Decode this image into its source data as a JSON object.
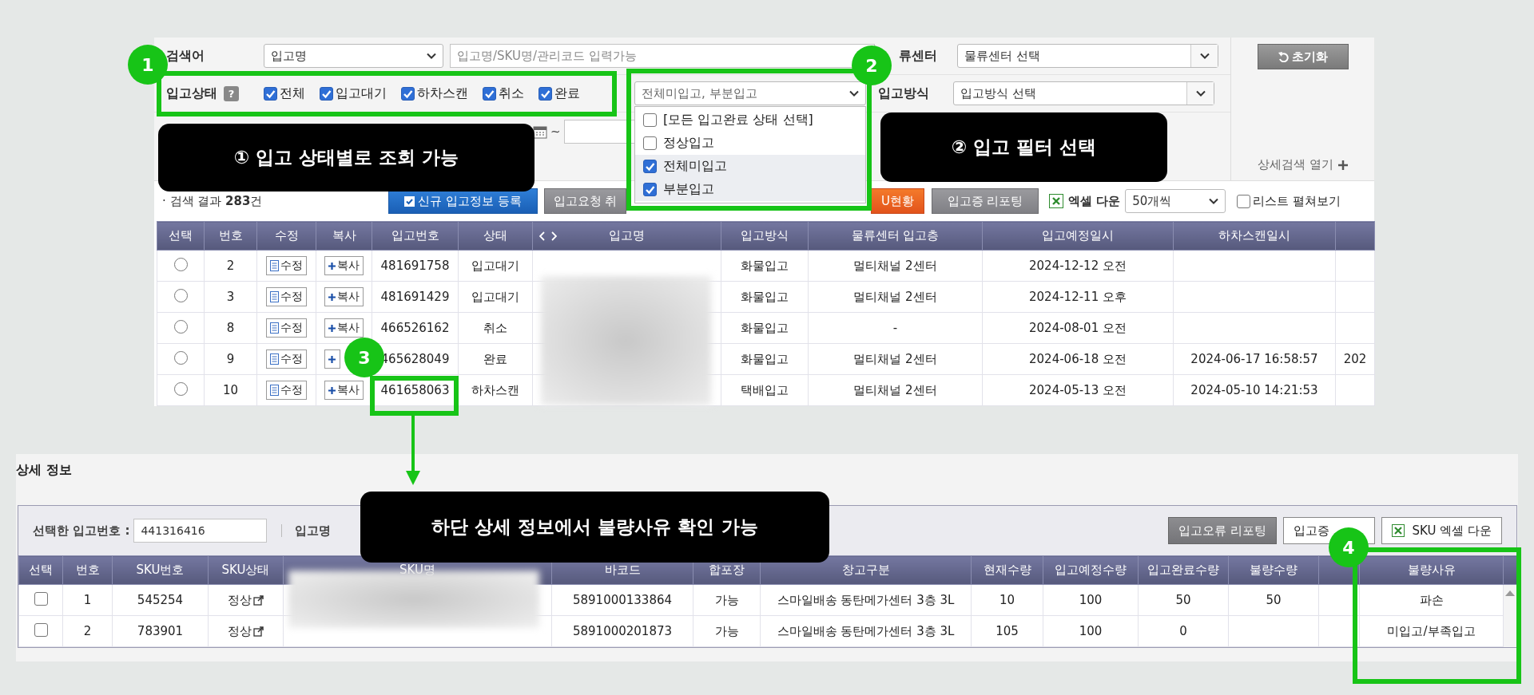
{
  "search": {
    "keyword_label": "검색어",
    "keyword_select": "입고명",
    "keyword_placeholder": "입고명/SKU명/관리코드 입력가능",
    "center_label": "류센터",
    "center_select": "물류센터 선택",
    "reset_button": "초기화",
    "status_label": "입고상태",
    "help_icon": "?",
    "status_checks": [
      {
        "label": "전체",
        "checked": true
      },
      {
        "label": "입고대기",
        "checked": true
      },
      {
        "label": "하차스캔",
        "checked": true
      },
      {
        "label": "취소",
        "checked": true
      },
      {
        "label": "완료",
        "checked": true
      }
    ],
    "filter_select": "전체미입고, 부분입고",
    "filter_options": [
      {
        "label": "[모든 입고완료 상태 선택]",
        "checked": false
      },
      {
        "label": "정상입고",
        "checked": false
      },
      {
        "label": "전체미입고",
        "checked": true
      },
      {
        "label": "부분입고",
        "checked": true
      }
    ],
    "method_label": "입고방식",
    "method_select": "입고방식 선택",
    "date_separator": "~",
    "detail_toggle": "상세검색 열기"
  },
  "results": {
    "summary": "· 검색 결과 **283**건",
    "buttons": [
      {
        "label": "신규 입고정보 등록",
        "kind": "primary"
      },
      {
        "label": "입고요청 취",
        "kind": "secondary"
      },
      {
        "label": "U현황",
        "kind": "warning"
      },
      {
        "label": "입고증 리포팅",
        "kind": "secondary"
      }
    ],
    "excel_label": "엑셀 다운",
    "page_size": "50개씩",
    "expand_list": {
      "label": "리스트 펼쳐보기",
      "checked": false
    }
  },
  "receipts_table": {
    "columns": [
      "선택",
      "번호",
      "수정",
      "복사",
      "입고번호",
      "상태",
      "입고명",
      "입고방식",
      "물류센터 입고층",
      "입고예정일시",
      "하차스캔일시"
    ],
    "rows": [
      {
        "selected": false,
        "no": "2",
        "edit": "수정",
        "copy": "복사",
        "receipt_no": "481691758",
        "status": "입고대기",
        "method": "화물입고",
        "floor": "멀티채널 2센터",
        "scheduled": "2024-12-12 오전"
      },
      {
        "selected": false,
        "no": "3",
        "edit": "수정",
        "copy": "복사",
        "receipt_no": "481691429",
        "status": "입고대기",
        "method": "화물입고",
        "floor": "멀티채널 2센터",
        "scheduled": "2024-12-11 오후"
      },
      {
        "selected": false,
        "no": "8",
        "edit": "수정",
        "copy": "복사",
        "receipt_no": "466526162",
        "status": "취소",
        "method": "화물입고",
        "floor": "-",
        "scheduled": "2024-08-01 오전"
      },
      {
        "selected": false,
        "no": "9",
        "edit": "수정",
        "receipt_no": "465628049",
        "status": "완료",
        "method": "화물입고",
        "floor": "멀티채널 2센터",
        "scheduled": "2024-06-18 오전",
        "scanned": "2024-06-17 16:58:57",
        "column_12": "202"
      },
      {
        "selected": false,
        "no": "10",
        "edit": "수정",
        "copy": "복사",
        "receipt_no": "461658063",
        "status": "하차스캔",
        "method": "택배입고",
        "floor": "멀티채널 2센터",
        "scheduled": "2024-05-13 오전",
        "scanned": "2024-05-10 14:21:53"
      }
    ]
  },
  "details": {
    "title": "상세 정보",
    "selected_label": "선택한 입고번호 :",
    "selected_value": "441316416",
    "name_label": "입고명",
    "buttons": [
      {
        "label": "입고오류 리포팅",
        "kind": "dark"
      },
      {
        "label": "입고증",
        "kind": "plain"
      },
      {
        "label": "SKU 엑셀 다운",
        "kind": "excel"
      }
    ],
    "columns": [
      "선택",
      "번호",
      "SKU번호",
      "SKU상태",
      "SKU명",
      "바코드",
      "합포장",
      "창고구분",
      "현재수량",
      "입고예정수량",
      "입고완료수량",
      "불량수량",
      "불량사유"
    ],
    "rows": [
      {
        "checked": false,
        "no": "1",
        "sku_no": "545254",
        "sku_status": "정상",
        "barcode": "5891000133864",
        "combined": "가능",
        "warehouse": "스마일배송 동탄메가센터 3층 3L",
        "current_qty": "10",
        "expected_qty": "100",
        "completed_qty": "50",
        "defect_qty": "50",
        "defect_reason": "파손"
      },
      {
        "checked": false,
        "no": "2",
        "sku_no": "783901",
        "sku_status": "정상",
        "barcode": "5891000201873",
        "combined": "가능",
        "warehouse": "스마일배송 동탄메가센터 3층 3L",
        "current_qty": "105",
        "expected_qty": "100",
        "completed_qty": "0",
        "defect_reason": "미입고/부족입고"
      }
    ]
  },
  "annotations": {
    "badges": [
      "1",
      "2",
      "3",
      "4"
    ],
    "callouts": [
      "① 입고 상태별로 조회 가능",
      "② 입고 필터 선택",
      "하단 상세 정보에서 불량사유 확인 가능"
    ]
  }
}
